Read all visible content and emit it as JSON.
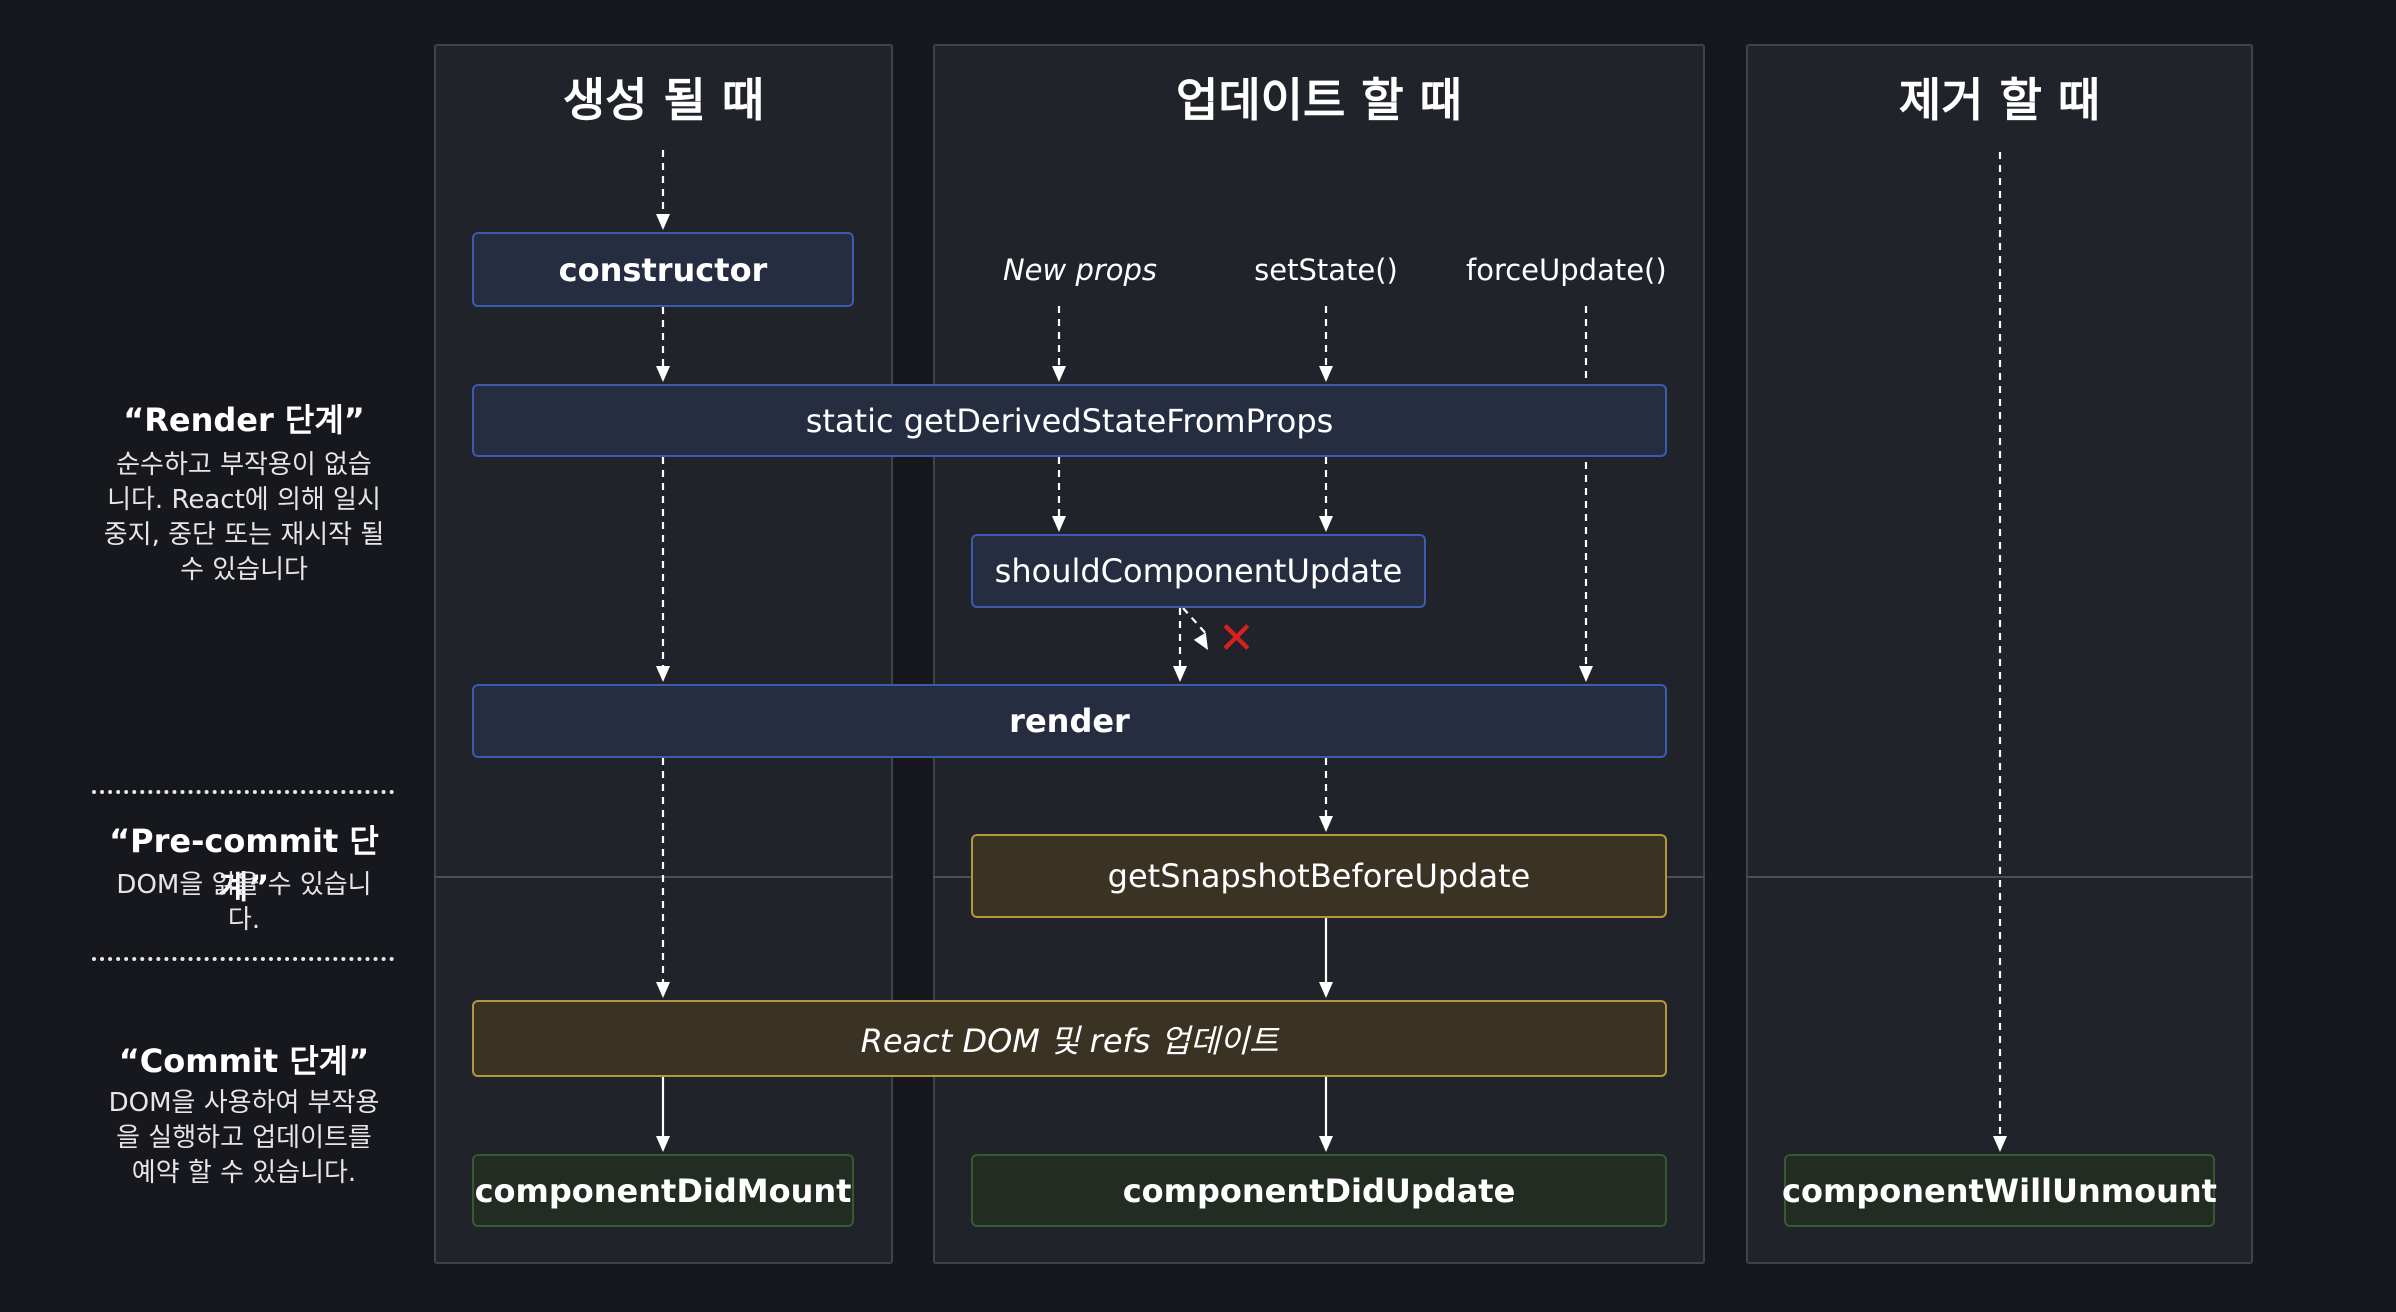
{
  "columns": {
    "mount": "생성 될 때",
    "update": "업데이트 할 때",
    "unmount": "제거 할 때"
  },
  "triggers": {
    "new_props": "New props",
    "set_state": "setState()",
    "force_update": "forceUpdate()"
  },
  "methods": {
    "constructor": "constructor",
    "get_derived_state": "static getDerivedStateFromProps",
    "should_update": "shouldComponentUpdate",
    "render": "render",
    "get_snapshot": "getSnapshotBeforeUpdate",
    "dom_update": "React DOM 및 refs 업데이트",
    "did_mount": "componentDidMount",
    "did_update": "componentDidUpdate",
    "will_unmount": "componentWillUnmount"
  },
  "phases": {
    "render": {
      "title": "“Render 단계”",
      "desc_lines": [
        "순수하고 부작용이 없습",
        "니다. React에 의해 일시",
        "중지, 중단 또는 재시작 될",
        "수 있습니다"
      ]
    },
    "precommit": {
      "title": "“Pre-commit 단계”",
      "desc_lines": [
        "DOM을 읽을 수 있습니",
        "다."
      ]
    },
    "commit": {
      "title": "“Commit 단계”",
      "desc_lines": [
        "DOM을 사용하여 부작용",
        "을 실행하고 업데이트를",
        "예약 할 수 있습니다."
      ]
    }
  },
  "colors": {
    "background": "#16181d",
    "column": "#20232a",
    "blue_border": "#3c5ab0",
    "yellow_border": "#b5963e",
    "green_border": "#355a2e",
    "cancel_mark": "#d9201c"
  },
  "icons": {
    "cancel": "x-mark-icon",
    "arrow": "arrow-down-icon"
  }
}
